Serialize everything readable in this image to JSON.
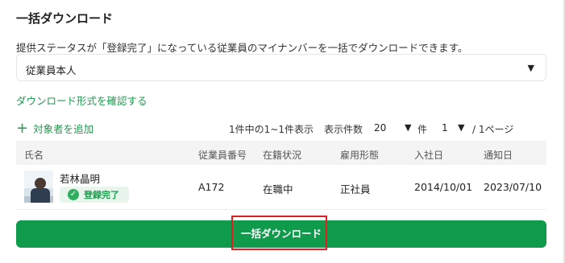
{
  "page": {
    "title": "一括ダウンロード",
    "description": "提供ステータスが「登録完了」になっている従業員のマイナンバーを一括でダウンロードできます。"
  },
  "target_select": {
    "value": "従業員本人",
    "arrow_icon": "triangle-down-icon"
  },
  "format_link": "ダウンロード形式を確認する",
  "toolbar": {
    "add_target": "対象者を追加",
    "add_icon": "plus-icon",
    "count_text": "1件中の1~1件表示",
    "per_page_label": "表示件数",
    "per_page_value": "20",
    "per_page_unit": "件",
    "page_value": "1",
    "page_total": "/ 1ページ"
  },
  "table": {
    "columns": [
      "氏名",
      "従業員番号",
      "在籍状況",
      "雇用形態",
      "入社日",
      "通知日"
    ],
    "rows": [
      {
        "name": "若林晶明",
        "status_badge": "登録完了",
        "employee_no": "A172",
        "enrollment": "在職中",
        "employment_type": "正社員",
        "hire_date": "2014/10/01",
        "notice_date": "2023/07/10"
      }
    ]
  },
  "download_button": "一括ダウンロード",
  "colors": {
    "accent": "#109a4c",
    "link": "#1f9a4f",
    "highlight": "#e02020"
  }
}
